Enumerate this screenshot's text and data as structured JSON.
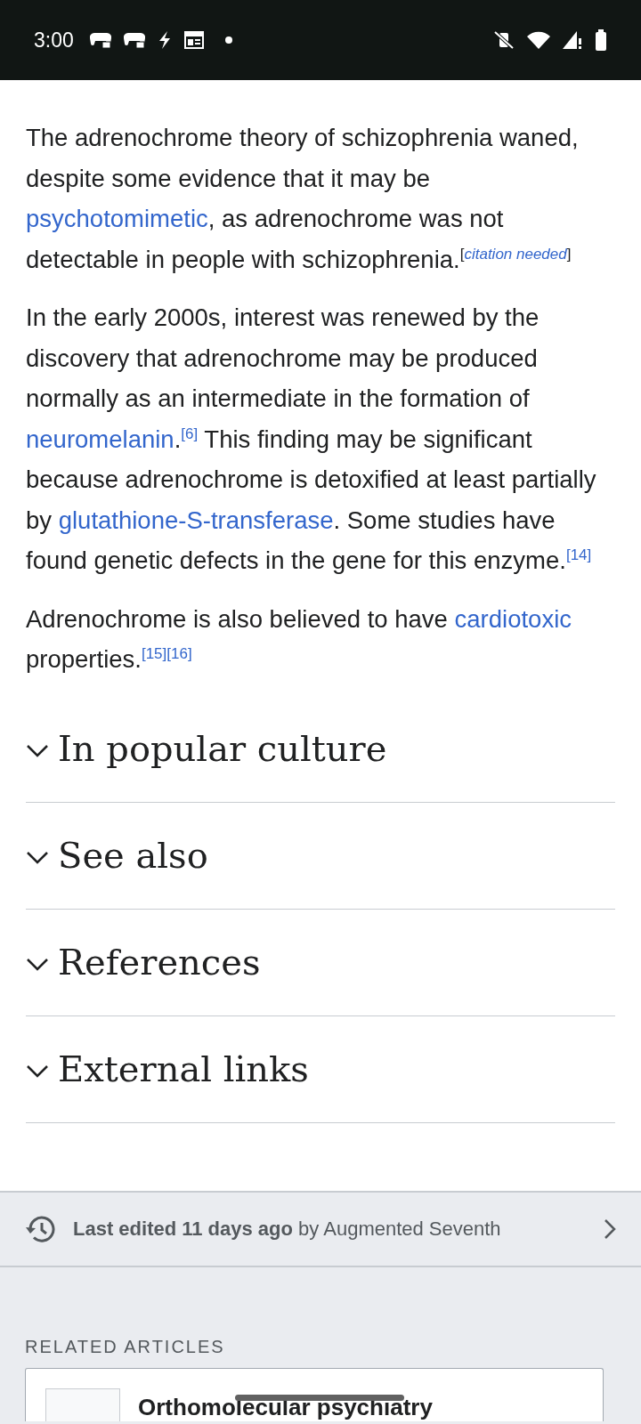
{
  "status_bar": {
    "time": "3:00"
  },
  "paragraphs": [
    [
      {
        "kind": "text",
        "text": "The adrenochrome theory of schizophrenia waned, despite some evidence that it may be "
      },
      {
        "kind": "link",
        "text": "psychotomimetic"
      },
      {
        "kind": "text",
        "text": ", as adrenochrome was not detectable in people with schizophrenia."
      },
      {
        "kind": "sup",
        "text": "["
      },
      {
        "kind": "sup-link-italic",
        "text": "citation needed"
      },
      {
        "kind": "sup",
        "text": "]"
      }
    ],
    [
      {
        "kind": "text",
        "text": "In the early 2000s, interest was renewed by the discovery that adrenochrome may be produced normally as an intermediate in the formation of "
      },
      {
        "kind": "link",
        "text": "neuromelanin"
      },
      {
        "kind": "text",
        "text": "."
      },
      {
        "kind": "sup-link",
        "text": "[6]"
      },
      {
        "kind": "text",
        "text": " This finding may be significant because adrenochrome is detoxified at least partially by "
      },
      {
        "kind": "link",
        "text": "glutathione-S-transferase"
      },
      {
        "kind": "text",
        "text": ". Some studies have found genetic defects in the gene for this enzyme."
      },
      {
        "kind": "sup-link",
        "text": "[14]"
      }
    ],
    [
      {
        "kind": "text",
        "text": "Adrenochrome is also believed to have "
      },
      {
        "kind": "link",
        "text": "cardiotoxic"
      },
      {
        "kind": "text",
        "text": " properties."
      },
      {
        "kind": "sup-link",
        "text": "[15]"
      },
      {
        "kind": "sup-link",
        "text": "[16]"
      }
    ]
  ],
  "sections": [
    {
      "title": "In popular culture",
      "expanded": false
    },
    {
      "title": "See also",
      "expanded": false
    },
    {
      "title": "References",
      "expanded": false
    },
    {
      "title": "External links",
      "expanded": false
    }
  ],
  "last_edited": "**Last edited 11 days ago** by Augmented Seventh",
  "related_heading": "RELATED ARTICLES",
  "related": [
    {
      "title": "Orthomolecular psychiatry"
    }
  ]
}
